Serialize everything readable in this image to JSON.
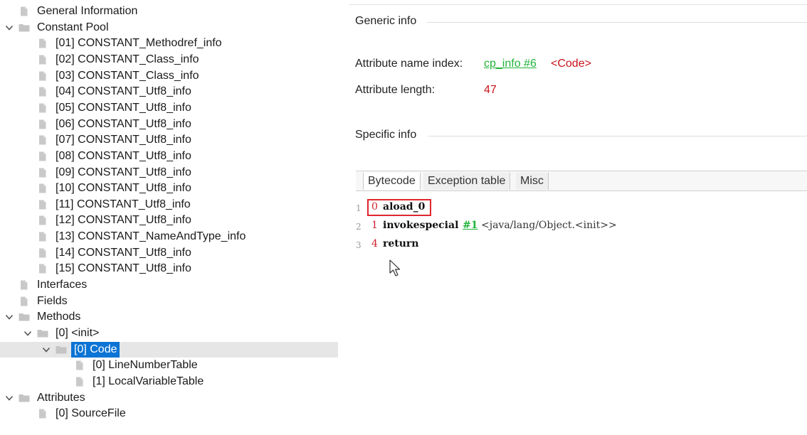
{
  "tree": {
    "items": [
      {
        "label": "General Information",
        "depth": 1,
        "expander": "none",
        "icon": "file"
      },
      {
        "label": "Constant Pool",
        "depth": 1,
        "expander": "expanded",
        "icon": "folder"
      },
      {
        "label": "[01] CONSTANT_Methodref_info",
        "depth": 2,
        "expander": "none",
        "icon": "file"
      },
      {
        "label": "[02] CONSTANT_Class_info",
        "depth": 2,
        "expander": "none",
        "icon": "file"
      },
      {
        "label": "[03] CONSTANT_Class_info",
        "depth": 2,
        "expander": "none",
        "icon": "file"
      },
      {
        "label": "[04] CONSTANT_Utf8_info",
        "depth": 2,
        "expander": "none",
        "icon": "file"
      },
      {
        "label": "[05] CONSTANT_Utf8_info",
        "depth": 2,
        "expander": "none",
        "icon": "file"
      },
      {
        "label": "[06] CONSTANT_Utf8_info",
        "depth": 2,
        "expander": "none",
        "icon": "file"
      },
      {
        "label": "[07] CONSTANT_Utf8_info",
        "depth": 2,
        "expander": "none",
        "icon": "file"
      },
      {
        "label": "[08] CONSTANT_Utf8_info",
        "depth": 2,
        "expander": "none",
        "icon": "file"
      },
      {
        "label": "[09] CONSTANT_Utf8_info",
        "depth": 2,
        "expander": "none",
        "icon": "file"
      },
      {
        "label": "[10] CONSTANT_Utf8_info",
        "depth": 2,
        "expander": "none",
        "icon": "file"
      },
      {
        "label": "[11] CONSTANT_Utf8_info",
        "depth": 2,
        "expander": "none",
        "icon": "file"
      },
      {
        "label": "[12] CONSTANT_Utf8_info",
        "depth": 2,
        "expander": "none",
        "icon": "file"
      },
      {
        "label": "[13] CONSTANT_NameAndType_info",
        "depth": 2,
        "expander": "none",
        "icon": "file"
      },
      {
        "label": "[14] CONSTANT_Utf8_info",
        "depth": 2,
        "expander": "none",
        "icon": "file"
      },
      {
        "label": "[15] CONSTANT_Utf8_info",
        "depth": 2,
        "expander": "none",
        "icon": "file"
      },
      {
        "label": "Interfaces",
        "depth": 1,
        "expander": "none",
        "icon": "file"
      },
      {
        "label": "Fields",
        "depth": 1,
        "expander": "none",
        "icon": "file"
      },
      {
        "label": "Methods",
        "depth": 1,
        "expander": "expanded",
        "icon": "folder"
      },
      {
        "label": "[0] <init>",
        "depth": 2,
        "expander": "expanded",
        "icon": "folder"
      },
      {
        "label": "[0] Code",
        "depth": 3,
        "expander": "expanded",
        "icon": "folder",
        "selected": true
      },
      {
        "label": "[0] LineNumberTable",
        "depth": 4,
        "expander": "none",
        "icon": "file"
      },
      {
        "label": "[1] LocalVariableTable",
        "depth": 4,
        "expander": "none",
        "icon": "file"
      },
      {
        "label": "Attributes",
        "depth": 1,
        "expander": "expanded",
        "icon": "folder"
      },
      {
        "label": "[0] SourceFile",
        "depth": 2,
        "expander": "none",
        "icon": "file"
      }
    ]
  },
  "detail": {
    "generic_title": "Generic info",
    "attr_name_label": "Attribute name index:",
    "attr_name_link": "cp_info #6",
    "attr_name_value": "<Code>",
    "attr_length_label": "Attribute length:",
    "attr_length_value": "47",
    "specific_title": "Specific info",
    "tabs": [
      {
        "label": "Bytecode",
        "active": true
      },
      {
        "label": "Exception table",
        "active": false
      },
      {
        "label": "Misc",
        "active": false
      }
    ],
    "bytecode": [
      {
        "line": "1",
        "pc": "0",
        "op": "aload_0",
        "ref": "",
        "comment": "",
        "highlighted": true
      },
      {
        "line": "2",
        "pc": "1",
        "op": "invokespecial",
        "ref": "#1",
        "comment": "<java/lang/Object.<init>>",
        "highlighted": false
      },
      {
        "line": "3",
        "pc": "4",
        "op": "return",
        "ref": "",
        "comment": "",
        "highlighted": false
      }
    ]
  },
  "colors": {
    "selection": "#0b74d4",
    "selection_row": "#e6e6e6",
    "link": "#22b43a",
    "value_red": "#c8141c",
    "highlight_box": "#e0262e"
  },
  "icons": {
    "expanded": "chevron-down-icon",
    "file": "file-icon",
    "folder": "folder-icon",
    "cursor": "mouse-pointer-icon"
  }
}
